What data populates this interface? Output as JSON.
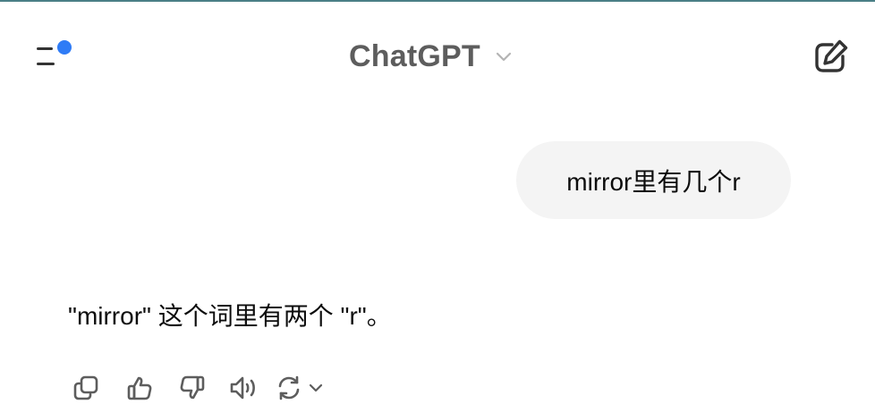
{
  "header": {
    "title": "ChatGPT",
    "icons": {
      "menu": "sidebar-menu-icon",
      "notification": "notification-dot",
      "chevron": "chevron-down-icon",
      "new_chat": "new-chat-pencil-icon"
    }
  },
  "conversation": {
    "user_message": "mirror里有几个r",
    "assistant_message": "\"mirror\" 这个词里有两个 \"r\"。"
  },
  "message_actions": [
    {
      "name": "copy",
      "icon": "copy-icon"
    },
    {
      "name": "good-response",
      "icon": "thumbs-up-icon"
    },
    {
      "name": "bad-response",
      "icon": "thumbs-down-icon"
    },
    {
      "name": "read-aloud",
      "icon": "speaker-icon"
    },
    {
      "name": "regenerate",
      "icon": "regenerate-icon"
    }
  ],
  "colors": {
    "accent_dot": "#2f7cf6",
    "bubble_bg": "#f4f4f4",
    "title": "#5d5d5d",
    "text": "#0d0d0d",
    "icon": "#5d5d5d",
    "top_bar": "#4a7f86"
  }
}
